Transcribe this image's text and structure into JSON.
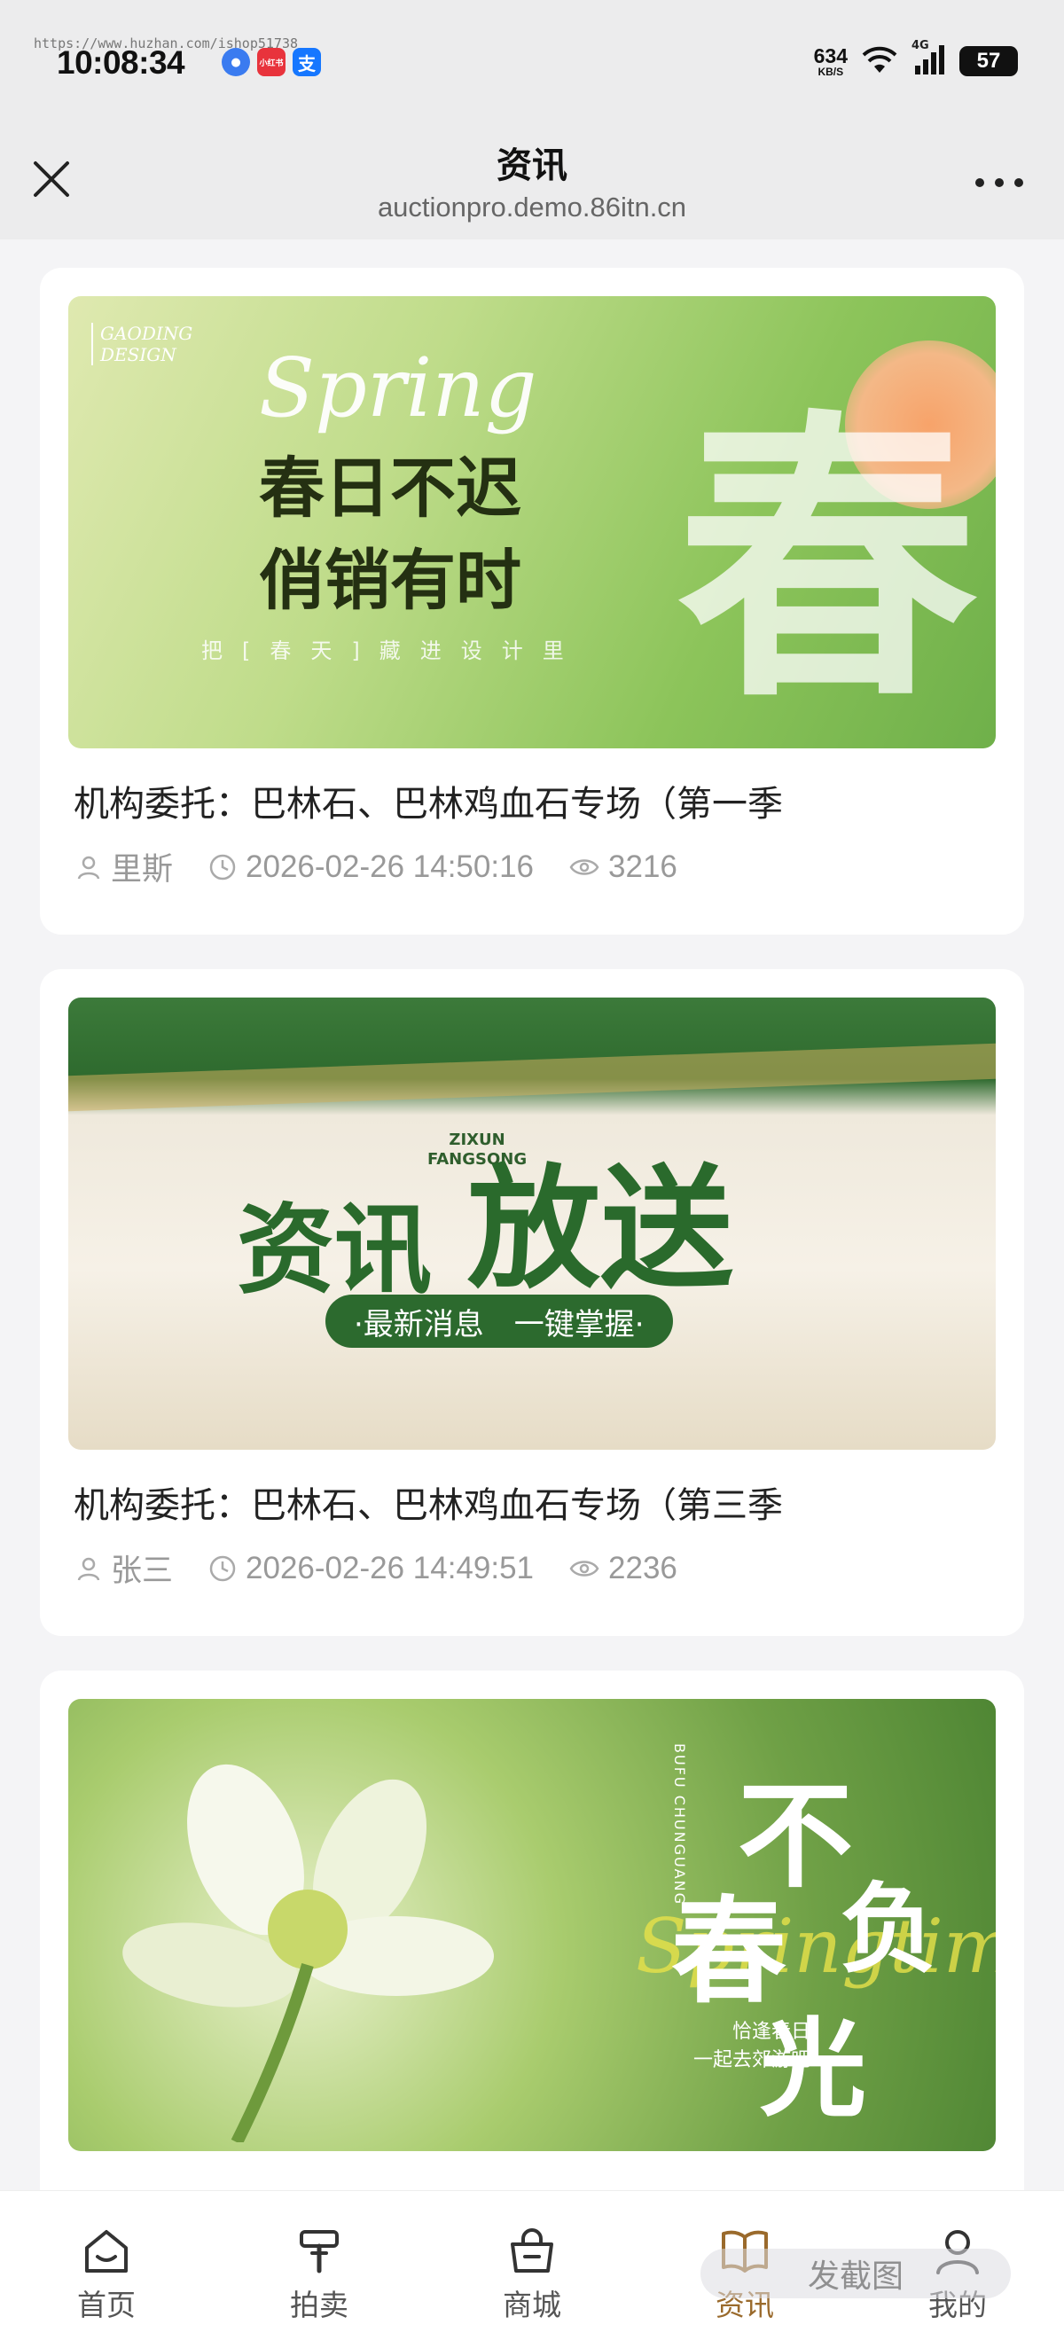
{
  "status_bar": {
    "watermark": "https://www.huzhan.com/ishop51738",
    "time": "10:08:34",
    "apps": [
      {
        "name": "blue-app-icon",
        "glyph": "●",
        "color": "#3a7bf0"
      },
      {
        "name": "xiaohongshu-icon",
        "glyph": "小红书",
        "color": "#e8333c"
      },
      {
        "name": "alipay-icon",
        "glyph": "支",
        "color": "#1677ff"
      }
    ],
    "net_speed": "634",
    "net_unit": "KB/S",
    "network": "4G",
    "battery": "57"
  },
  "nav": {
    "title": "资讯",
    "url": "auctionpro.demo.86itn.cn"
  },
  "articles": [
    {
      "title": "机构委托：巴林石、巴林鸡血石专场（第一季",
      "author": "里斯",
      "datetime": "2026-02-26 14:50:16",
      "views": "3216",
      "banner": {
        "brand": "GAODING\nDESIGN",
        "headline_en": "Spring",
        "headline_line1": "春日不迟",
        "headline_line2": "俏销有时",
        "tagline": "把[春天]藏进设计里",
        "big_char": "春"
      }
    },
    {
      "title": "机构委托：巴林石、巴林鸡血石专场（第三季",
      "author": "张三",
      "datetime": "2026-02-26 14:49:51",
      "views": "2236",
      "banner": {
        "brand": "ZIXUN\nFANGSONG",
        "word1": "资讯",
        "word2": "放送",
        "pill": "·最新消息　一键掌握·"
      }
    },
    {
      "banner": {
        "vertical": "BUFU CHUNGUANG",
        "char1": "不",
        "char2": "负",
        "char3": "春",
        "char4": "光",
        "script": "Springtime",
        "small": "恰逢春日\n一起去郊游吧"
      }
    }
  ],
  "tabs": [
    {
      "label": "首页",
      "icon": "home-icon",
      "active": false
    },
    {
      "label": "拍卖",
      "icon": "auction-hammer-icon",
      "active": false
    },
    {
      "label": "商城",
      "icon": "shopping-bag-icon",
      "active": false
    },
    {
      "label": "资讯",
      "icon": "book-icon",
      "active": true
    },
    {
      "label": "我的",
      "icon": "user-icon",
      "active": false
    }
  ],
  "screenshot_hint": "发截图",
  "colors": {
    "active_tab": "#9a6a2c",
    "meta_text": "#999999",
    "background": "#f4f4f6"
  }
}
